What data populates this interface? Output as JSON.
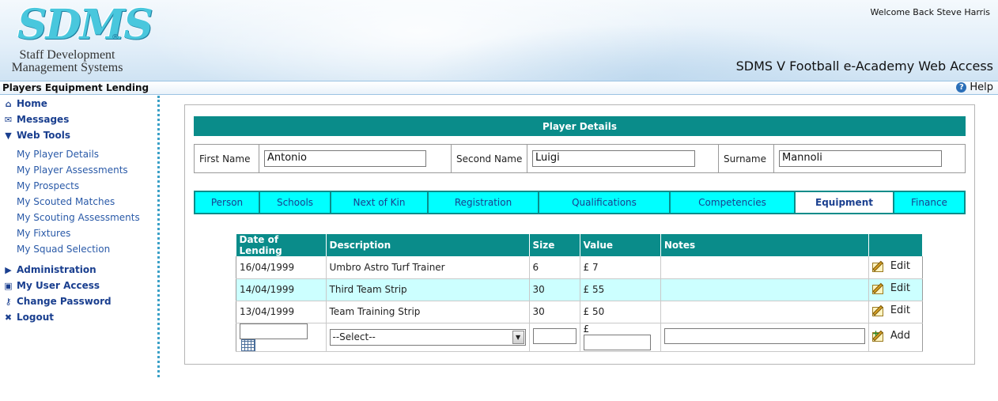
{
  "header": {
    "logo_mark": "SDMS",
    "logo_reg": "®",
    "logo_line1": "Staff Development",
    "logo_line2": "Management Systems",
    "welcome": "Welcome Back Steve Harris",
    "app_title": "SDMS V Football e-Academy Web Access"
  },
  "titlebar": {
    "page_heading": "Players Equipment Lending",
    "help_label": "Help"
  },
  "sidebar": {
    "main_items": [
      {
        "label": "Home",
        "icon": "home-icon"
      },
      {
        "label": "Messages",
        "icon": "messages-icon"
      },
      {
        "label": "Web Tools",
        "icon": "expand-triangle-icon"
      }
    ],
    "sub_items": [
      "My Player Details",
      "My Player Assessments",
      "My Prospects",
      "My Scouted Matches",
      "My Scouting Assessments",
      "My Fixtures",
      "My Squad Selection"
    ],
    "lower_items": [
      {
        "label": "Administration",
        "icon": "collapsed-triangle-icon"
      },
      {
        "label": "My User Access",
        "icon": "lock-icon"
      },
      {
        "label": "Change Password",
        "icon": "key-icon"
      },
      {
        "label": "Logout",
        "icon": "logout-x-icon"
      }
    ]
  },
  "player_details": {
    "header": "Player Details",
    "first_name_label": "First Name",
    "first_name": "Antonio",
    "second_name_label": "Second Name",
    "second_name": "Luigi",
    "surname_label": "Surname",
    "surname": "Mannoli"
  },
  "tabs": [
    "Person",
    "Schools",
    "Next of Kin",
    "Registration",
    "Qualifications",
    "Competencies",
    "Equipment",
    "Finance"
  ],
  "active_tab": "Equipment",
  "equipment": {
    "columns": [
      "Date of Lending",
      "Description",
      "Size",
      "Value",
      "Notes",
      ""
    ],
    "rows": [
      {
        "date": "16/04/1999",
        "description": "Umbro Astro Turf Trainer",
        "size": "6",
        "value": "£ 7",
        "notes": "",
        "action": "Edit"
      },
      {
        "date": "14/04/1999",
        "description": "Third Team Strip",
        "size": "30",
        "value": "£ 55",
        "notes": "",
        "action": "Edit"
      },
      {
        "date": "13/04/1999",
        "description": "Team Training Strip",
        "size": "30",
        "value": "£ 50",
        "notes": "",
        "action": "Edit"
      }
    ],
    "new_row": {
      "select_value": "--Select--",
      "currency": "£",
      "action": "Add"
    }
  },
  "colors": {
    "teal": "#0a8c8a",
    "tab_cyan": "#00ffff",
    "alt_row": "#ccffff",
    "nav_blue": "#1a3f8f"
  }
}
